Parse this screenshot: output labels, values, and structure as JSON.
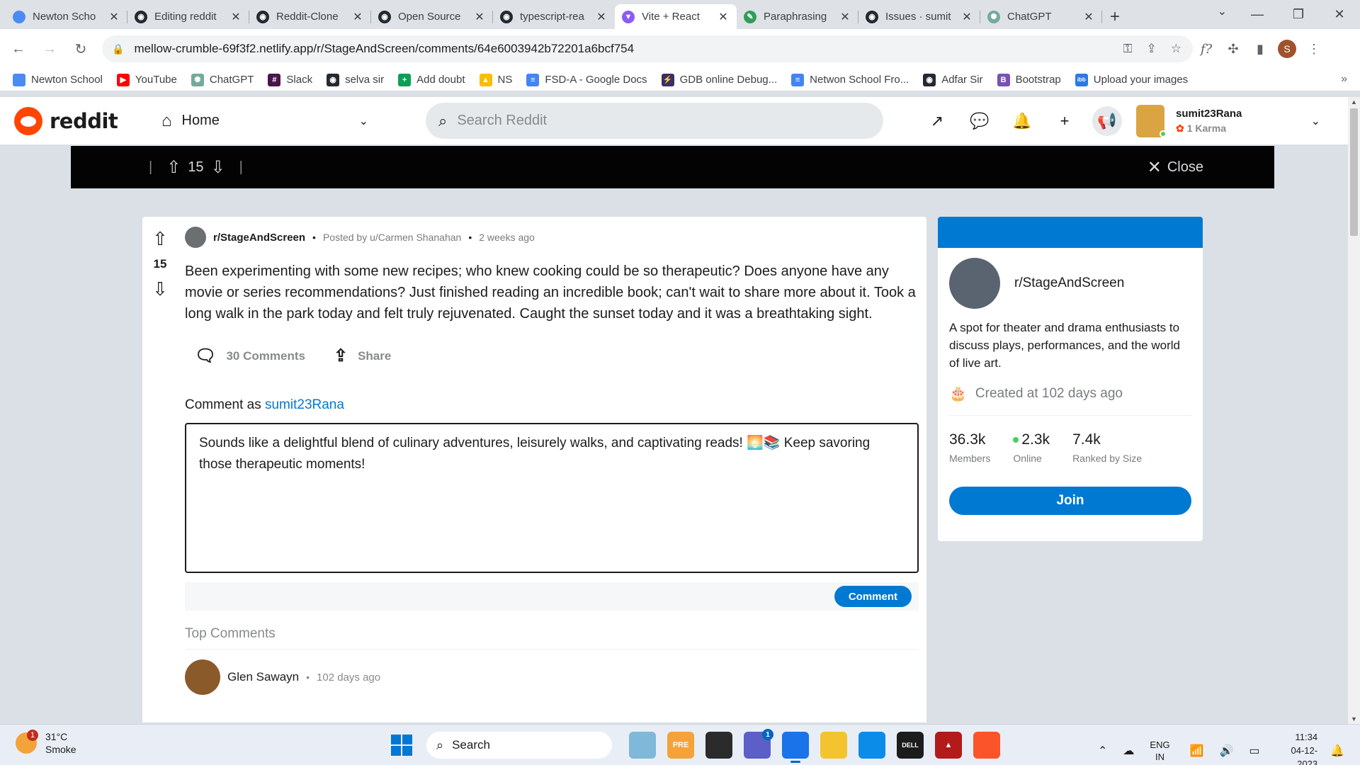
{
  "browser": {
    "tabs": [
      {
        "title": "Newton Scho",
        "color": "#4c8bf5",
        "glyph": ""
      },
      {
        "title": "Editing reddit",
        "color": "#24292f",
        "glyph": "◉"
      },
      {
        "title": "Reddit-Clone",
        "color": "#24292f",
        "glyph": "◉"
      },
      {
        "title": "Open Source",
        "color": "#24292f",
        "glyph": "◉"
      },
      {
        "title": "typescript-rea",
        "color": "#24292f",
        "glyph": "◉"
      },
      {
        "title": "Vite + React",
        "color": "#8a5cf6",
        "glyph": "▼"
      },
      {
        "title": "Paraphrasing",
        "color": "#2e9e56",
        "glyph": "✎"
      },
      {
        "title": "Issues · sumit",
        "color": "#24292f",
        "glyph": "◉"
      },
      {
        "title": "ChatGPT",
        "color": "#74aa9c",
        "glyph": "✺"
      }
    ],
    "active_tab_index": 5,
    "new_tab": "+",
    "url": "mellow-crumble-69f3f2.netlify.app/r/StageAndScreen/comments/64e6003942b72201a6bcf754",
    "profile_initial": "S",
    "bookmarks": [
      {
        "label": "Newton School",
        "color": "#4c8bf5",
        "glyph": ""
      },
      {
        "label": "YouTube",
        "color": "#ff0000",
        "glyph": "▶"
      },
      {
        "label": "ChatGPT",
        "color": "#74aa9c",
        "glyph": "✺"
      },
      {
        "label": "Slack",
        "color": "#4a154b",
        "glyph": "#"
      },
      {
        "label": "selva sir",
        "color": "#24292f",
        "glyph": "◉"
      },
      {
        "label": "Add doubt",
        "color": "#0f9d58",
        "glyph": "+"
      },
      {
        "label": "NS",
        "color": "#fbbc04",
        "glyph": "▲"
      },
      {
        "label": "FSD-A - Google Docs",
        "color": "#4285f4",
        "glyph": "≡"
      },
      {
        "label": "GDB online Debug...",
        "color": "#3b2f63",
        "glyph": "⚡"
      },
      {
        "label": "Netwon School Fro...",
        "color": "#4285f4",
        "glyph": "≡"
      },
      {
        "label": "Adfar Sir",
        "color": "#24292f",
        "glyph": "◉"
      },
      {
        "label": "Bootstrap",
        "color": "#7952b3",
        "glyph": "B"
      },
      {
        "label": "Upload your images",
        "color": "#2a7ae2",
        "glyph": "ibb"
      }
    ]
  },
  "reddit": {
    "logo_text": "reddit",
    "home_label": "Home",
    "search_placeholder": "Search Reddit",
    "user": {
      "name": "sumit23Rana",
      "karma": "1 Karma"
    },
    "postbar": {
      "score": "15",
      "close_label": "Close"
    },
    "post": {
      "subreddit": "r/StageAndScreen",
      "posted_by": "Posted by u/Carmen Shanahan",
      "time": "2 weeks ago",
      "score": "15",
      "body": "Been experimenting with some new recipes; who knew cooking could be so therapeutic? Does anyone have any movie or series recommendations? Just finished reading an incredible book; can't wait to share more about it. Took a long walk in the park today and felt truly rejuvenated. Caught the sunset today and it was a breathtaking sight.",
      "comments_label": "30 Comments",
      "share_label": "Share",
      "comment_as_prefix": "Comment as",
      "comment_as_user": "sumit23Rana",
      "comment_draft": "Sounds like a delightful blend of culinary adventures, leisurely walks, and captivating reads! 🌅📚 Keep savoring those therapeutic moments!",
      "comment_button": "Comment",
      "top_comments_label": "Top Comments",
      "first_comment": {
        "author": "Glen Sawayn",
        "time": "102 days ago"
      }
    },
    "sidebar": {
      "name": "r/StageAndScreen",
      "description": "A spot for theater and drama enthusiasts to discuss plays, performances, and the world of live art.",
      "created": "Created at 102 days ago",
      "stats": [
        {
          "value": "36.3k",
          "label": "Members",
          "online": false
        },
        {
          "value": "2.3k",
          "label": "Online",
          "online": true
        },
        {
          "value": "7.4k",
          "label": "Ranked by Size",
          "online": false
        }
      ],
      "join_label": "Join"
    }
  },
  "taskbar": {
    "weather": {
      "temp": "31°C",
      "condition": "Smoke",
      "badge": "1"
    },
    "search_label": "Search",
    "apps": [
      {
        "name": "copilot",
        "color": "#7fb8d9",
        "label": "",
        "badge": "",
        "running": false
      },
      {
        "name": "widgets",
        "color": "#f3a33a",
        "label": "PRE",
        "badge": "",
        "running": false
      },
      {
        "name": "task-view",
        "color": "#2b2b2b",
        "label": "",
        "badge": "",
        "running": false
      },
      {
        "name": "teams",
        "color": "#5b5fc7",
        "label": "",
        "badge": "1",
        "running": false
      },
      {
        "name": "chrome",
        "color": "#1a73e8",
        "label": "",
        "badge": "",
        "running": true
      },
      {
        "name": "file-explorer",
        "color": "#f4c430",
        "label": "",
        "badge": "",
        "running": false
      },
      {
        "name": "edge",
        "color": "#0c8ce9",
        "label": "",
        "badge": "",
        "running": false
      },
      {
        "name": "dell",
        "color": "#1c1c1c",
        "label": "DELL",
        "badge": "",
        "running": false
      },
      {
        "name": "autodesk",
        "color": "#b31b1b",
        "label": "▲",
        "badge": "",
        "running": false
      },
      {
        "name": "brave",
        "color": "#fb542b",
        "label": "",
        "badge": "",
        "running": false
      }
    ],
    "language": "ENG",
    "region": "IN",
    "time": "11:34",
    "date": "04-12-2023"
  }
}
